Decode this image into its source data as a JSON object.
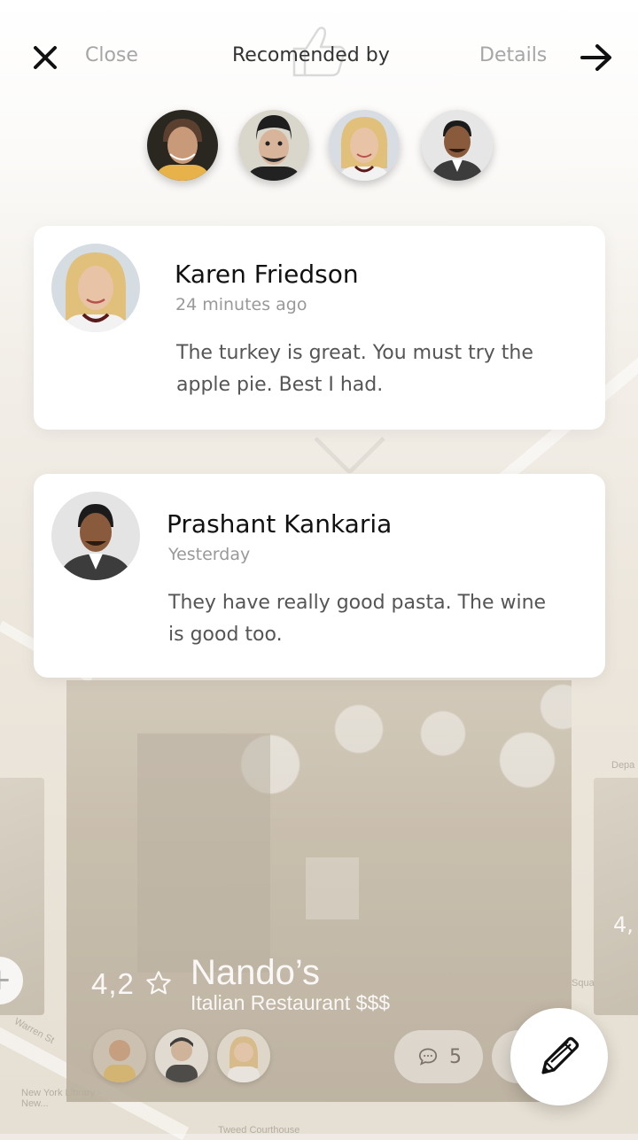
{
  "header": {
    "close_label": "Close",
    "title": "Recomended by",
    "details_label": "Details"
  },
  "recommenders": [
    {
      "name": "recommender-1",
      "skin": "#c89a7a",
      "hair": "#5b4030",
      "shirt": "#e7b24a"
    },
    {
      "name": "recommender-2",
      "skin": "#d8b49a",
      "hair": "#1e1e1e",
      "shirt": "#222222"
    },
    {
      "name": "recommender-3",
      "skin": "#e9c3a5",
      "hair": "#e1c07c",
      "shirt": "#f2f2f2"
    },
    {
      "name": "recommender-4",
      "skin": "#8a5a3c",
      "hair": "#1b1b1b",
      "shirt": "#3c3c3c"
    }
  ],
  "reviews": [
    {
      "name": "Karen Friedson",
      "time": "24 minutes ago",
      "text": "The turkey is great. You must try the apple pie. Best I had."
    },
    {
      "name": "Prashant Kankaria",
      "time": "Yesterday",
      "text": "They have really good pasta. The wine is good too."
    }
  ],
  "restaurant": {
    "rating": "4,2",
    "name": "Nando’s",
    "type": "Italian Restaurant  $$$",
    "comment_count": "5"
  },
  "side_card_number": "4,",
  "map_labels": {
    "street": "Warren St",
    "library": "New York Library - New...",
    "courthouse": "Tweed Courthouse",
    "department": "Depa",
    "square": "Squa"
  },
  "colors": {
    "accent_dark": "#111111",
    "muted_text": "#a6a6a6"
  }
}
